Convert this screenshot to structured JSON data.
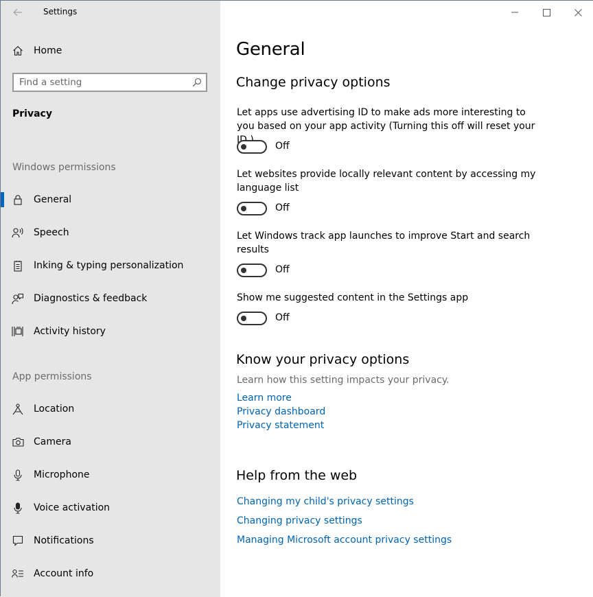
{
  "window": {
    "title": "Settings"
  },
  "sidebar": {
    "home_label": "Home",
    "search_placeholder": "Find a setting",
    "current_section": "Privacy",
    "groups": [
      {
        "header": "Windows permissions",
        "items": [
          {
            "label": "General",
            "icon": "lock-icon",
            "selected": true
          },
          {
            "label": "Speech",
            "icon": "speech-icon"
          },
          {
            "label": "Inking & typing personalization",
            "icon": "inking-icon"
          },
          {
            "label": "Diagnostics & feedback",
            "icon": "diagnostics-icon"
          },
          {
            "label": "Activity history",
            "icon": "activity-history-icon"
          }
        ]
      },
      {
        "header": "App permissions",
        "items": [
          {
            "label": "Location",
            "icon": "location-icon"
          },
          {
            "label": "Camera",
            "icon": "camera-icon"
          },
          {
            "label": "Microphone",
            "icon": "microphone-icon"
          },
          {
            "label": "Voice activation",
            "icon": "voice-activation-icon"
          },
          {
            "label": "Notifications",
            "icon": "notifications-icon"
          },
          {
            "label": "Account info",
            "icon": "account-info-icon"
          }
        ]
      }
    ]
  },
  "main": {
    "title": "General",
    "change_heading": "Change privacy options",
    "options": [
      {
        "desc": "Let apps use advertising ID to make ads more interesting to you based on your app activity (Turning this off will reset your ID.)",
        "state": "Off"
      },
      {
        "desc": "Let websites provide locally relevant content by accessing my language list",
        "state": "Off"
      },
      {
        "desc": "Let Windows track app launches to improve Start and search results",
        "state": "Off"
      },
      {
        "desc": "Show me suggested content in the Settings app",
        "state": "Off"
      }
    ],
    "know_heading": "Know your privacy options",
    "know_desc": "Learn how this setting impacts your privacy.",
    "know_links": [
      "Learn more",
      "Privacy dashboard",
      "Privacy statement"
    ],
    "help_heading": "Help from the web",
    "help_links": [
      "Changing my child's privacy settings",
      "Changing privacy settings",
      "Managing Microsoft account privacy settings"
    ]
  },
  "colors": {
    "accent": "#0067c0",
    "link": "#0063b1",
    "sidebar_bg": "#e6e6e6"
  }
}
